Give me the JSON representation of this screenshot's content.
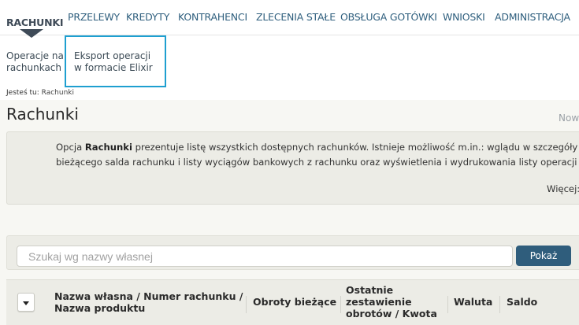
{
  "nav": {
    "active": "RACHUNKI",
    "items": [
      "PRZELEWY",
      "KREDYTY",
      "KONTRAHENCI",
      "ZLECENIA STAŁE",
      "OBSŁUGA GOTÓWKI",
      "WNIOSKI",
      "ADMINISTRACJA"
    ]
  },
  "subnav": {
    "item1_line1": "Operacje na",
    "item1_line2": "rachunkach",
    "item2_line1": "Eksport operacji",
    "item2_line2": "w formacie Elixir"
  },
  "breadcrumb": {
    "label": "Jesteś tu:",
    "current": "Rachunki"
  },
  "page": {
    "title": "Rachunki",
    "top_right": "Now"
  },
  "info": {
    "line1_before": "Opcja ",
    "line1_bold": "Rachunki",
    "line1_after": " prezentuje listę wszystkich dostępnych rachunków. Istnieje możliwość m.in.: wglądu w szczegóły infor",
    "line2": "bieżącego salda rachunku i listy wyciągów bankowych z rachunku oraz wyświetlenia i wydrukowania listy operacji z dnia",
    "more": "Więcej:"
  },
  "search": {
    "placeholder": "Szukaj wg nazwy własnej",
    "button": "Pokaż"
  },
  "table": {
    "col1_line1": "Nazwa własna / Numer rachunku /",
    "col1_line2": "Nazwa produktu",
    "col2": "Obroty bieżące",
    "col3_line1": "Ostatnie",
    "col3_line2": "zestawienie",
    "col3_line3": "obrotów / Kwota",
    "col4": "Waluta",
    "col5": "Saldo"
  },
  "colors": {
    "accent": "#1e9fd0",
    "nav_link": "#2f5f7e",
    "button": "#2f5d7c",
    "active_nav": "#3e4a57"
  }
}
